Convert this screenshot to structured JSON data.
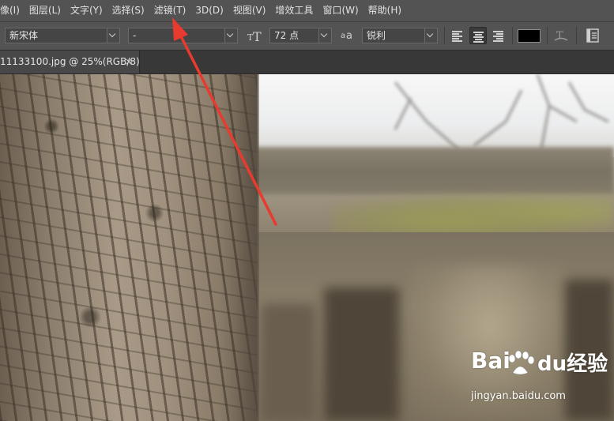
{
  "menubar": {
    "items": [
      {
        "label": "像(I)"
      },
      {
        "label": "图层(L)"
      },
      {
        "label": "文字(Y)"
      },
      {
        "label": "选择(S)"
      },
      {
        "label": "滤镜(T)"
      },
      {
        "label": "3D(D)"
      },
      {
        "label": "视图(V)"
      },
      {
        "label": "增效工具"
      },
      {
        "label": "窗口(W)"
      },
      {
        "label": "帮助(H)"
      }
    ]
  },
  "options": {
    "font_family": "新宋体",
    "font_style": "-",
    "font_size": "72 点",
    "antialias": "锐利",
    "text_color": "#000000",
    "align_active": "center"
  },
  "document": {
    "tab_title": "11133100.jpg @ 25%(RGB/8)",
    "tab_close": "×"
  },
  "watermark": {
    "brand_left": "Bai",
    "brand_right": "du",
    "brand_cn": "经验",
    "url": "jingyan.baidu.com"
  },
  "colors": {
    "arrow": "#e83a2e",
    "ui_bg": "#535353"
  },
  "icons": [
    "text-size-icon",
    "antialias-icon",
    "align-left-icon",
    "align-center-icon",
    "align-right-icon",
    "warp-text-icon",
    "character-panel-icon",
    "close-icon"
  ]
}
